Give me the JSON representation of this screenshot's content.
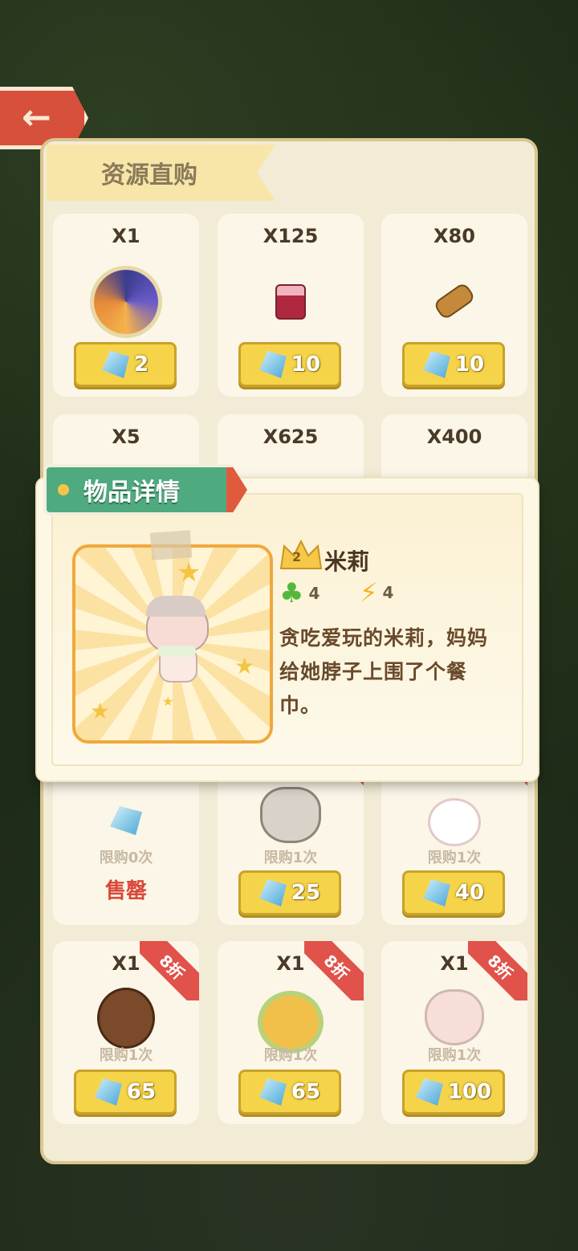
{
  "header": {
    "back_icon": "back-arrow-icon",
    "shop_title": "资源直购"
  },
  "shop": {
    "rows": [
      [
        {
          "qty": "X1",
          "icon": "swirl-orb-icon",
          "price": "2"
        },
        {
          "qty": "X125",
          "icon": "jam-jar-icon",
          "price": "10"
        },
        {
          "qty": "X80",
          "icon": "wood-log-icon",
          "price": "10"
        }
      ],
      [
        {
          "qty": "X5"
        },
        {
          "qty": "X625"
        },
        {
          "qty": "X400"
        }
      ],
      [
        {
          "icon": "diamond-icon",
          "limit": "限购0次",
          "status": "售罄"
        },
        {
          "icon": "tiger-character",
          "limit": "限购1次",
          "price": "25"
        },
        {
          "icon": "bunny-character",
          "limit": "限购1次",
          "price": "40"
        }
      ],
      [
        {
          "qty": "X1",
          "icon": "duck-character",
          "limit": "限购1次",
          "price": "65",
          "discount": "8折"
        },
        {
          "qty": "X1",
          "icon": "lion-character",
          "limit": "限购1次",
          "price": "65",
          "discount": "8折"
        },
        {
          "qty": "X1",
          "icon": "cat-character",
          "limit": "限购1次",
          "price": "100",
          "discount": "8折"
        }
      ]
    ]
  },
  "detail": {
    "tab_title": "物品详情",
    "level": "2",
    "name": "米莉",
    "stat_clover": "4",
    "stat_energy": "4",
    "description": "贪吃爱玩的米莉，妈妈给她脖子上围了个餐巾。"
  }
}
